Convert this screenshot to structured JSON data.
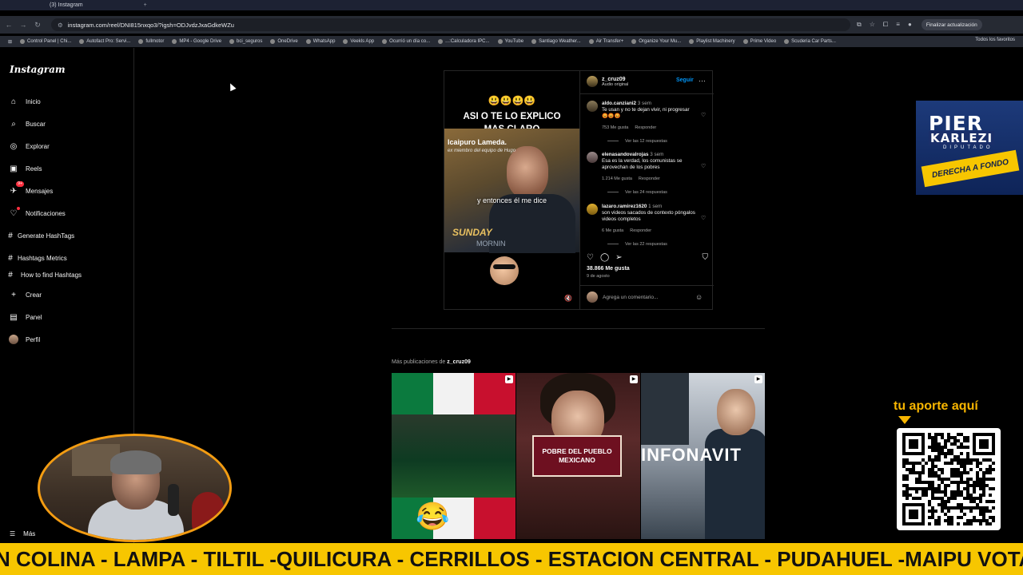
{
  "browser": {
    "tab_title": "(3) Instagram",
    "url": "instagram.com/reel/DNI815nxqo3/?igsh=ODJvdzJxaGdkeWZu",
    "update_label": "Finalizar actualización",
    "bookmarks": [
      "Control Panel | Chi...",
      "Autofact Pro: Servi...",
      "fullmotor",
      "MP4 - Google Drive",
      "bci_seguros",
      "OneDrive",
      "WhatsApp",
      "Veekls App",
      "Ocurrió un día co...",
      "...:Calculadora IPC...",
      "YouTube",
      "Santiago Weather...",
      "Air Transfer+",
      "Organize Your Mu...",
      "Playlist Machinery",
      "Prime Video",
      "Scuderia Car Parts..."
    ],
    "all_favorites": "Todos los favoritos"
  },
  "sidebar": {
    "logo": "Instagram",
    "items": [
      {
        "label": "Inicio",
        "icon": "home-icon"
      },
      {
        "label": "Buscar",
        "icon": "search-icon"
      },
      {
        "label": "Explorar",
        "icon": "compass-icon"
      },
      {
        "label": "Reels",
        "icon": "reels-icon"
      },
      {
        "label": "Mensajes",
        "icon": "messenger-icon",
        "badge": "9+"
      },
      {
        "label": "Notificaciones",
        "icon": "heart-icon"
      },
      {
        "label": "Generate HashTags",
        "icon": "hashtag-icon"
      },
      {
        "label": "Hashtags Metrics",
        "icon": "hashtag-icon"
      },
      {
        "label": "How to find Hashtags",
        "icon": "hashtag-icon"
      },
      {
        "label": "Crear",
        "icon": "plus-icon"
      },
      {
        "label": "Panel",
        "icon": "panel-icon"
      },
      {
        "label": "Perfil",
        "icon": "avatar"
      }
    ],
    "more_label": "Más"
  },
  "post": {
    "video": {
      "emojis": "😃😃😃😃",
      "title_line1": "ASI O TE LO EXPLICO",
      "title_line2": "MAS CLARO",
      "name": "lcaipuro Lameda.",
      "subname": "ex miembro del equipo de Hugo",
      "caption": "y entonces él me dice",
      "show1": "SUNDAY",
      "show2": "MORNIN"
    },
    "author": "z_cruz09",
    "audio": "Audio original",
    "follow_label": "Seguir",
    "comments": [
      {
        "user": "aldo.canziani2",
        "time": "3 sem",
        "text": "Te usan y no te dejan vivir, ni progresar 😡😡😡",
        "likes": "753 Me gusta",
        "reply": "Responder",
        "replies": "Ver las 12 respuestas"
      },
      {
        "user": "elenasandovalrojas",
        "time": "3 sem",
        "text": "Esa es la verdad, los comunistas se aprovechan de los pobres",
        "likes": "1.214 Me gusta",
        "reply": "Responder",
        "replies": "Ver las 24 respuestas"
      },
      {
        "user": "lazaro.ramirez1620",
        "time": "1 sem",
        "text": "son videos sacados de contexto póngalos videos completos",
        "likes": "6 Me gusta",
        "reply": "Responder",
        "replies": "Ver las 22 respuestas"
      }
    ],
    "likes": "38.866 Me gusta",
    "date": "9 de agosto",
    "comment_placeholder": "Agrega un comentario..."
  },
  "more_posts": {
    "prefix": "Más publicaciones de",
    "user": "z_cruz09",
    "thumb2_text": "POBRE DEL PUEBLO MEXICANO",
    "thumb3_text": "INFONAVIT"
  },
  "overlay": {
    "pier_line1": "PIER",
    "pier_line2": "KARLEZI",
    "pier_sub": "DIPUTADO",
    "pier_slogan": "DERECHA A FONDO",
    "aporte": "tu aporte aquí",
    "ticker": "N COLINA - LAMPA - TILTIL -QUILICURA - CERRILLOS - ESTACION CENTRAL - PUDAHUEL -MAIPU VOTA"
  },
  "colors": {
    "accent_blue": "#0095f6",
    "ticker_yellow": "#f7c600",
    "cam_ring": "#f39c12"
  }
}
